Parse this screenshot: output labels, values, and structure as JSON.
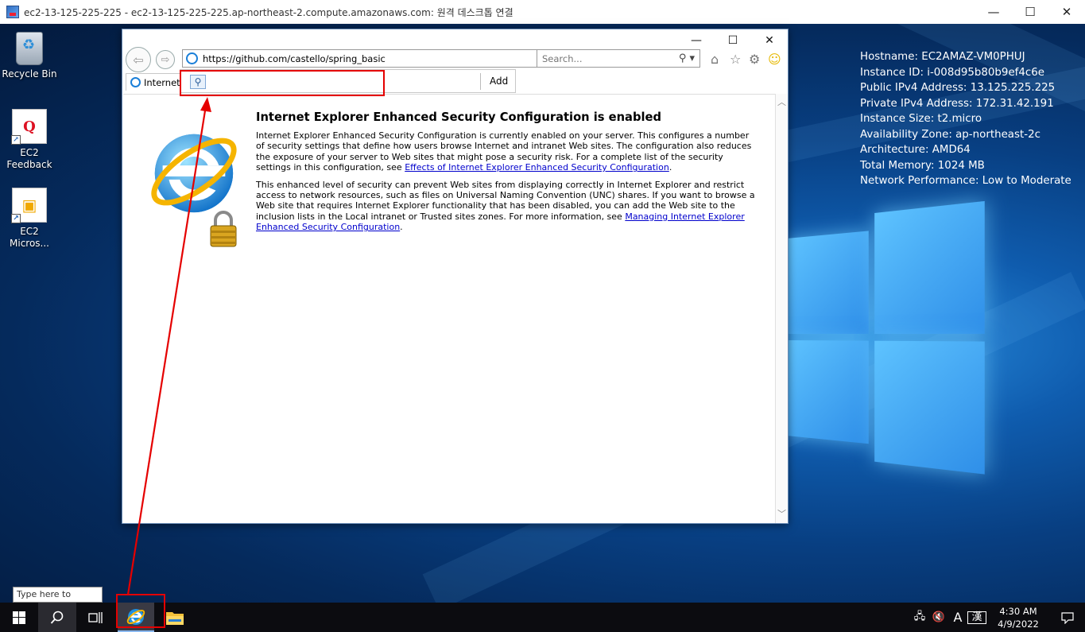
{
  "rdp": {
    "title": "ec2-13-125-225-225 - ec2-13-125-225-225.ap-northeast-2.compute.amazonaws.com: 원격 데스크톱 연결",
    "minimize": "—",
    "maximize": "☐",
    "close": "✕"
  },
  "desktop": {
    "icons": [
      {
        "label": "Recycle Bin"
      },
      {
        "label": "EC2\nFeedback",
        "tile": "Q"
      },
      {
        "label": "EC2\nMicros...",
        "tile": "▣"
      }
    ],
    "sysinfo": [
      "Hostname: EC2AMAZ-VM0PHUJ",
      "Instance ID: i-008d95b80b9ef4c6e",
      "Public IPv4 Address: 13.125.225.225",
      "Private IPv4 Address: 172.31.42.191",
      "Instance Size: t2.micro",
      "Availability Zone: ap-northeast-2c",
      "Architecture: AMD64",
      "Total Memory: 1024 MB",
      "Network Performance: Low to Moderate"
    ]
  },
  "ie": {
    "address": "https://github.com/castello/spring_basic",
    "search_placeholder": "Search...",
    "tab_label": "Internet",
    "dropdown_add": "Add",
    "heading": "Internet Explorer Enhanced Security Configuration is enabled",
    "p1_text": "Internet Explorer Enhanced Security Configuration is currently enabled on your server. This configures a number of security settings that define how users browse Internet and intranet Web sites. The configuration also reduces the exposure of your server to Web sites that might pose a security risk. For a complete list of the security settings in this configuration, see ",
    "p1_link": "Effects of Internet Explorer Enhanced Security Configuration",
    "p1_end": ".",
    "p2_text": "This enhanced level of security can prevent Web sites from displaying correctly in Internet Explorer and restrict access to network resources, such as files on Universal Naming Convention (UNC) shares. If you want to browse a Web site that requires Internet Explorer functionality that has been disabled, you can add the Web site to the inclusion lists in the Local intranet or Trusted sites zones. For more information, see ",
    "p2_link": "Managing Internet Explorer Enhanced Security Configuration",
    "p2_end": "."
  },
  "taskbar": {
    "search_tip": "Type here to search",
    "time": "4:30 AM",
    "date": "4/9/2022",
    "ime": "A",
    "ime2": "漢"
  },
  "colors": {
    "annotation": "#e50000",
    "link": "#0000cc",
    "taskbar": "#0c0c10"
  }
}
